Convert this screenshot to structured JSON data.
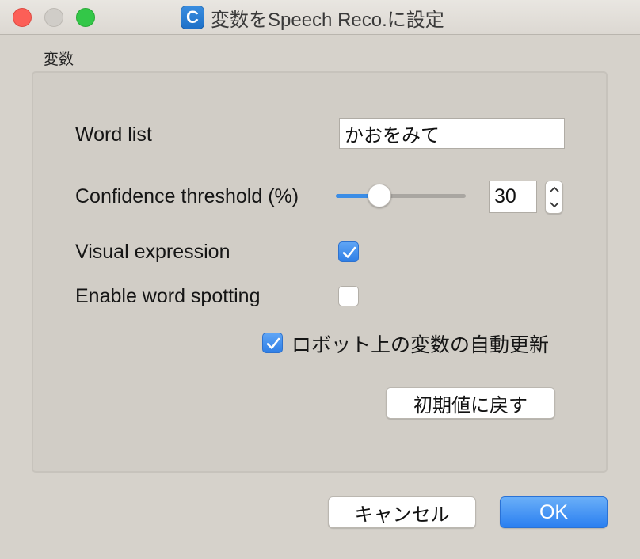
{
  "window": {
    "title": "変数をSpeech Reco.に設定",
    "app_icon_letter": "C"
  },
  "section": {
    "label": "変数"
  },
  "form": {
    "word_list_label": "Word list",
    "word_list_value": "かおをみて",
    "confidence_label": "Confidence threshold (%)",
    "confidence_value": "30",
    "confidence_slider_fraction": 0.3,
    "visual_expression_label": "Visual expression",
    "visual_expression_checked": true,
    "word_spotting_label": "Enable word spotting",
    "word_spotting_checked": false,
    "auto_update_label": "ロボット上の変数の自動更新",
    "auto_update_checked": true,
    "reset_button_label": "初期値に戻す"
  },
  "footer": {
    "cancel_label": "キャンセル",
    "ok_label": "OK"
  },
  "colors": {
    "accent": "#2f7fe6",
    "close": "#fc5f57",
    "maximize": "#33c748"
  },
  "icons": {
    "check": "check-icon",
    "chevron_up": "chevron-up-icon",
    "chevron_down": "chevron-down-icon"
  }
}
